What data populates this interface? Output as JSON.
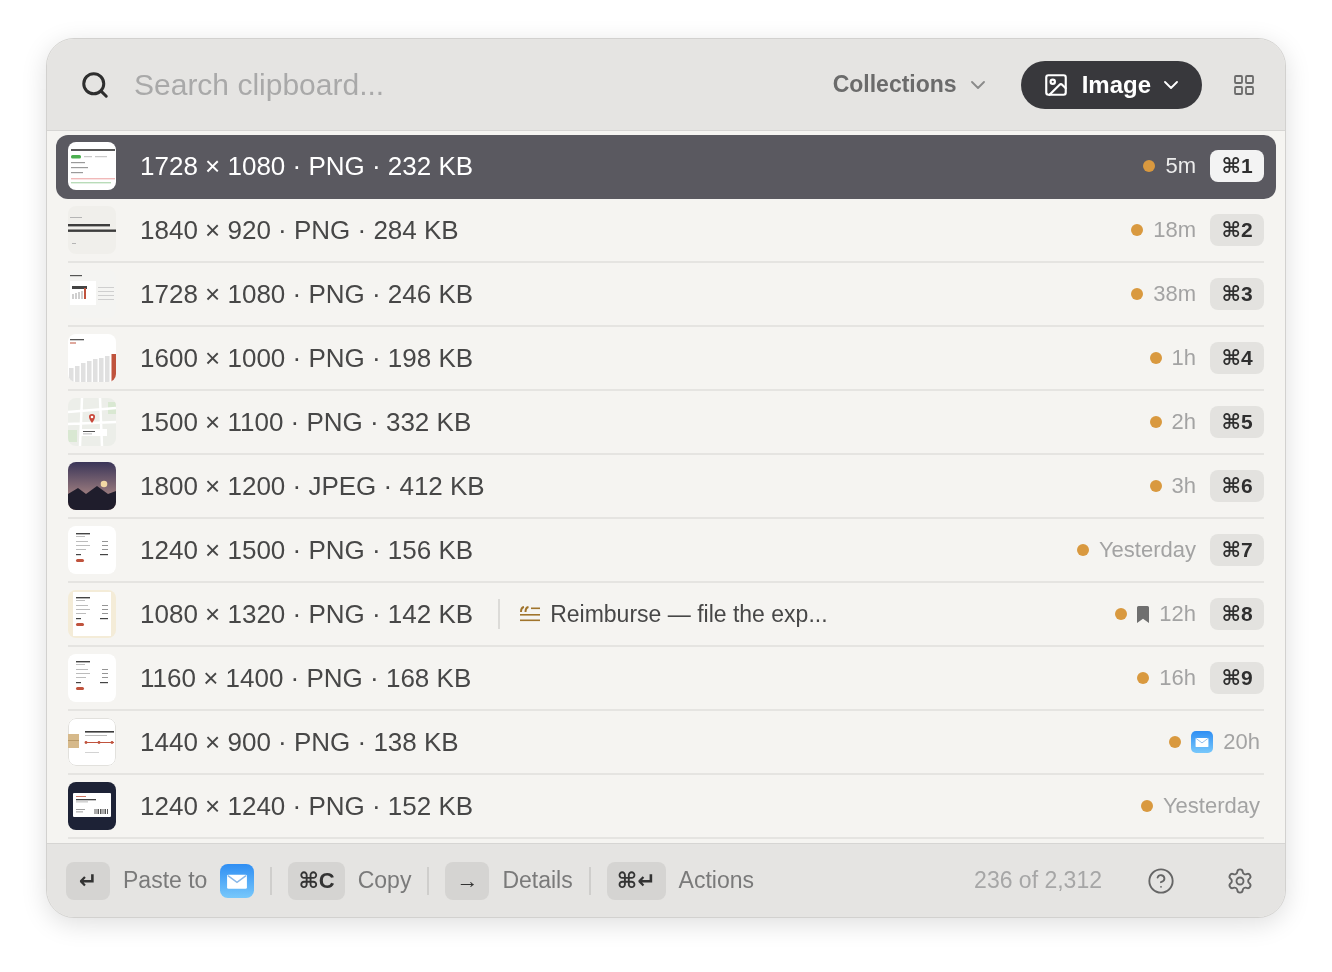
{
  "search": {
    "placeholder": "Search clipboard..."
  },
  "collections": {
    "label": "Collections"
  },
  "filter": {
    "label": "Image"
  },
  "rows": [
    {
      "kind": "document",
      "info": "1728 × 1080 · PNG · 232 KB",
      "time": "5m",
      "bookmarked": false,
      "app_icon": false,
      "shortcut": "⌘1",
      "selected": true
    },
    {
      "kind": "headline",
      "info": "1840 × 920 · PNG · 284 KB",
      "time": "18m",
      "bookmarked": false,
      "app_icon": false,
      "shortcut": "⌘2",
      "selected": false
    },
    {
      "kind": "dashboard",
      "info": "1728 × 1080 · PNG · 246 KB",
      "time": "38m",
      "bookmarked": false,
      "app_icon": false,
      "shortcut": "⌘3",
      "selected": false
    },
    {
      "kind": "chart",
      "info": "1600 × 1000 · PNG · 198 KB",
      "time": "1h",
      "bookmarked": false,
      "app_icon": false,
      "shortcut": "⌘4",
      "selected": false
    },
    {
      "kind": "map",
      "info": "1500 × 1100 · PNG · 332 KB",
      "time": "2h",
      "bookmarked": false,
      "app_icon": false,
      "shortcut": "⌘5",
      "selected": false
    },
    {
      "kind": "photo",
      "info": "1800 × 1200 · JPEG · 412 KB",
      "time": "3h",
      "bookmarked": false,
      "app_icon": false,
      "shortcut": "⌘6",
      "selected": false
    },
    {
      "kind": "receipt",
      "info": "1240 × 1500 · PNG · 156 KB",
      "time": "Yesterday",
      "bookmarked": false,
      "app_icon": false,
      "shortcut": "⌘7",
      "selected": false
    },
    {
      "kind": "invoice",
      "info": "1080 × 1320 · PNG · 142 KB",
      "note": "Reimburse — file the exp...",
      "time": "12h",
      "bookmarked": true,
      "app_icon": false,
      "shortcut": "⌘8",
      "selected": false
    },
    {
      "kind": "receipt",
      "info": "1160 × 1400 · PNG · 168 KB",
      "time": "16h",
      "bookmarked": false,
      "app_icon": false,
      "shortcut": "⌘9",
      "selected": false
    },
    {
      "kind": "package",
      "info": "1440 × 900 · PNG · 138 KB",
      "time": "20h",
      "bookmarked": false,
      "app_icon": true,
      "selected": false
    },
    {
      "kind": "ticket",
      "info": "1240 × 1240 · PNG · 152 KB",
      "time": "Yesterday",
      "bookmarked": false,
      "app_icon": false,
      "selected": false
    }
  ],
  "footer": {
    "actions": [
      {
        "key": "↵",
        "label": "Paste to",
        "app_icon": true
      },
      {
        "key": "⌘C",
        "label": "Copy",
        "app_icon": false
      },
      {
        "key": "→",
        "label": "Details",
        "app_icon": false
      },
      {
        "key": "⌘↵",
        "label": "Actions",
        "app_icon": false
      }
    ],
    "count": "236 of 2,312"
  }
}
